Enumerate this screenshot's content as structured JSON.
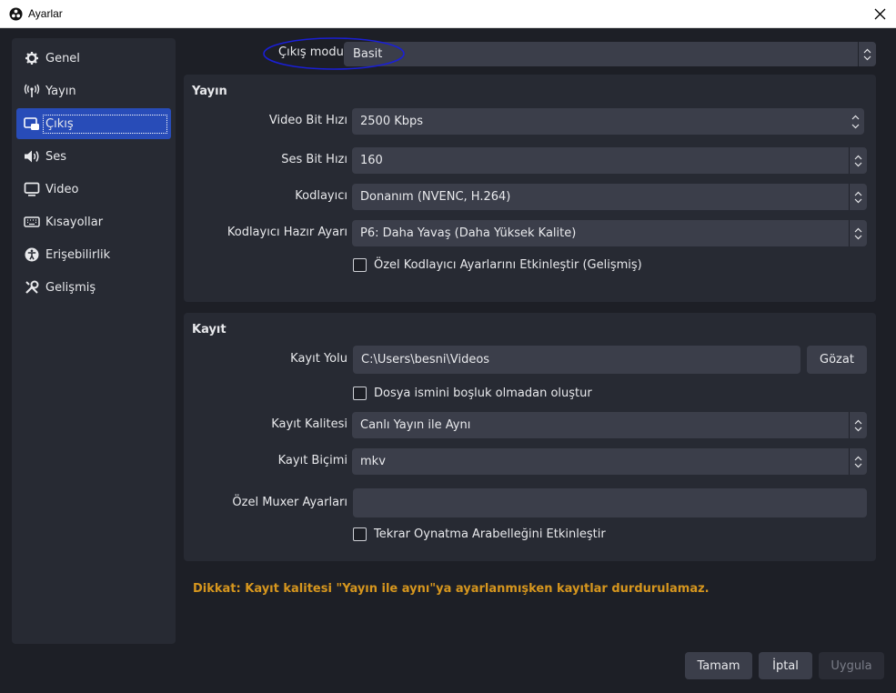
{
  "window": {
    "title": "Ayarlar"
  },
  "sidebar": {
    "items": [
      {
        "label": "Genel",
        "icon": "gear-icon"
      },
      {
        "label": "Yayın",
        "icon": "antenna-icon"
      },
      {
        "label": "Çıkış",
        "icon": "output-icon",
        "active": true
      },
      {
        "label": "Ses",
        "icon": "speaker-icon"
      },
      {
        "label": "Video",
        "icon": "monitor-icon"
      },
      {
        "label": "Kısayollar",
        "icon": "keyboard-icon"
      },
      {
        "label": "Erişebilirlik",
        "icon": "accessibility-icon"
      },
      {
        "label": "Gelişmiş",
        "icon": "tools-icon"
      }
    ]
  },
  "output_mode": {
    "label": "Çıkış modu",
    "value": "Basit"
  },
  "streaming": {
    "title": "Yayın",
    "video_bitrate": {
      "label": "Video Bit Hızı",
      "value": "2500 Kbps"
    },
    "audio_bitrate": {
      "label": "Ses Bit Hızı",
      "value": "160"
    },
    "encoder": {
      "label": "Kodlayıcı",
      "value": "Donanım (NVENC, H.264)"
    },
    "encoder_preset": {
      "label": "Kodlayıcı Hazır Ayarı",
      "value": "P6: Daha Yavaş (Daha Yüksek Kalite)"
    },
    "custom_encoder_checkbox": {
      "label": "Özel Kodlayıcı Ayarlarını Etkinleştir (Gelişmiş)",
      "checked": false
    }
  },
  "recording": {
    "title": "Kayıt",
    "path": {
      "label": "Kayıt Yolu",
      "value": "C:\\Users\\besni\\Videos",
      "browse_label": "Gözat"
    },
    "no_space_checkbox": {
      "label": "Dosya ismini boşluk olmadan oluştur",
      "checked": false
    },
    "quality": {
      "label": "Kayıt Kalitesi",
      "value": "Canlı Yayın ile Aynı"
    },
    "format": {
      "label": "Kayıt Biçimi",
      "value": "mkv"
    },
    "muxer": {
      "label": "Özel Muxer Ayarları",
      "value": ""
    },
    "replay_buffer_checkbox": {
      "label": "Tekrar Oynatma Arabelleğini Etkinleştir",
      "checked": false
    }
  },
  "warning": "Dikkat: Kayıt kalitesi \"Yayın ile aynı\"ya ayarlanmışken kayıtlar durdurulamaz.",
  "buttons": {
    "ok": "Tamam",
    "cancel": "İptal",
    "apply": "Uygula"
  },
  "colors": {
    "accent": "#284cb8",
    "warning": "#d6961e",
    "annotation": "#1a1fd6"
  }
}
